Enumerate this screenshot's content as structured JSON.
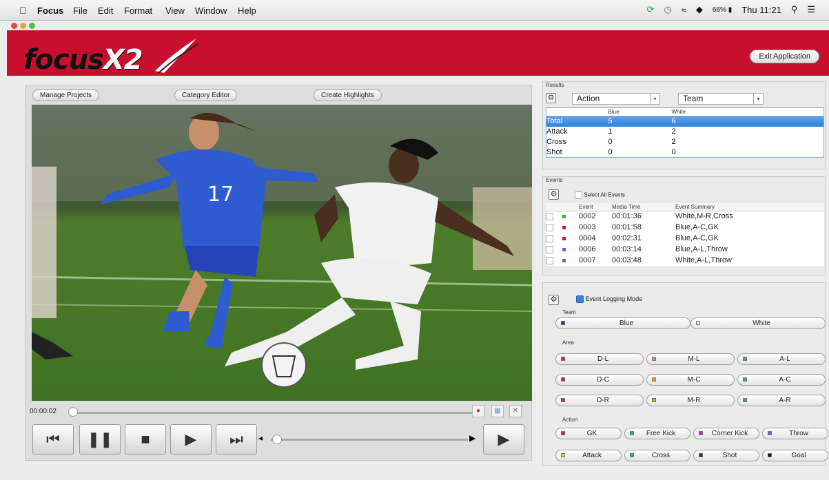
{
  "menubar": {
    "app": "Focus",
    "items": [
      "File",
      "Edit",
      "Format",
      "View",
      "Window",
      "Help"
    ],
    "battery": "66%",
    "clock": "Thu 11:21"
  },
  "header": {
    "logo_text": "focus",
    "logo_suffix": "X2",
    "exit_label": "Exit Application",
    "brand_color": "#c8102e"
  },
  "toolbar": {
    "manage_projects": "Manage Projects",
    "category_editor": "Category Editor",
    "create_highlights": "Create Highlights"
  },
  "player": {
    "time": "00:00:02",
    "jersey_number": "17",
    "progress_fraction": 0.0
  },
  "results": {
    "title": "Results",
    "row_select": "Action",
    "col_select": "Team",
    "columns": [
      "Blue",
      "White"
    ],
    "rows": [
      {
        "label": "Total",
        "blue": "5",
        "white": "6",
        "selected": true
      },
      {
        "label": "Attack",
        "blue": "1",
        "white": "2",
        "selected": false
      },
      {
        "label": "Cross",
        "blue": "0",
        "white": "2",
        "selected": false
      },
      {
        "label": "Shot",
        "blue": "0",
        "white": "0",
        "selected": false
      }
    ]
  },
  "events": {
    "title": "Events",
    "select_all": "Select All Events",
    "columns": [
      "Event",
      "Media Time",
      "Event Summary"
    ],
    "rows": [
      {
        "id": "0002",
        "time": "00:01:36",
        "summary": "White,M-R,Cross",
        "color": "#2db84a"
      },
      {
        "id": "0003",
        "time": "00:01:58",
        "summary": "Blue,A-C,GK",
        "color": "#d0202a"
      },
      {
        "id": "0004",
        "time": "00:02:31",
        "summary": "Blue,A-C,GK",
        "color": "#d0202a"
      },
      {
        "id": "0006",
        "time": "00:03:14",
        "summary": "Blue,A-L,Throw",
        "color": "#5a6bd0"
      },
      {
        "id": "0007",
        "time": "00:03:48",
        "summary": "White,A-L,Throw",
        "color": "#5a6bd0"
      }
    ]
  },
  "logging": {
    "mode_label": "Event Logging Mode",
    "team_label": "Team",
    "teams": [
      {
        "label": "Blue",
        "color": "#1a2bd0"
      },
      {
        "label": "White",
        "color": "#f5f0c8"
      }
    ],
    "area_label": "Area",
    "areas": [
      {
        "label": "D-L",
        "color": "#d0202a"
      },
      {
        "label": "M-L",
        "color": "#e89a2a"
      },
      {
        "label": "A-L",
        "color": "#2db84a"
      },
      {
        "label": "D-C",
        "color": "#d0202a"
      },
      {
        "label": "M-C",
        "color": "#e89a2a"
      },
      {
        "label": "A-C",
        "color": "#2db84a"
      },
      {
        "label": "D-R",
        "color": "#d0202a"
      },
      {
        "label": "M-R",
        "color": "#e89a2a"
      },
      {
        "label": "A-R",
        "color": "#2db84a"
      }
    ],
    "action_label": "Action",
    "actions": [
      {
        "label": "GK",
        "color": "#d0202a"
      },
      {
        "label": "Free Kick",
        "color": "#2db84a"
      },
      {
        "label": "Corner Kick",
        "color": "#b030c0"
      },
      {
        "label": "Throw",
        "color": "#5a6bd0"
      },
      {
        "label": "Attack",
        "color": "#e8d030"
      },
      {
        "label": "Cross",
        "color": "#2db84a"
      },
      {
        "label": "Shot",
        "color": "#333333"
      },
      {
        "label": "Goal",
        "color": "#111111"
      }
    ]
  }
}
